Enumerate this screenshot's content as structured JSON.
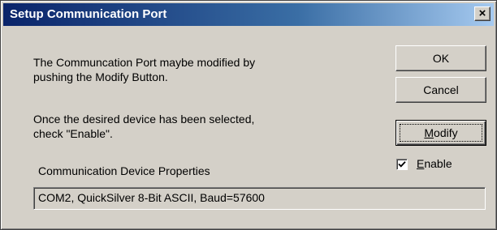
{
  "window": {
    "title": "Setup Communication Port",
    "close_label": "×"
  },
  "message": {
    "line1": "The Communcation Port maybe modified by",
    "line2": "pushing the Modify Button.",
    "line3": "Once the desired device has been selected,",
    "line4": "check \"Enable\"."
  },
  "buttons": {
    "ok_label": "OK",
    "cancel_label": "Cancel",
    "modify_prefix": "",
    "modify_mnemonic": "M",
    "modify_rest": "odify"
  },
  "enable": {
    "checked": true,
    "label_mnemonic": "E",
    "label_rest": "nable"
  },
  "properties": {
    "label": "Communication Device Properties",
    "value": "COM2, QuickSilver 8-Bit ASCII, Baud=57600"
  },
  "colors": {
    "title_gradient_start": "#0a246a",
    "title_gradient_end": "#a6caf0",
    "face": "#d4d0c8"
  }
}
